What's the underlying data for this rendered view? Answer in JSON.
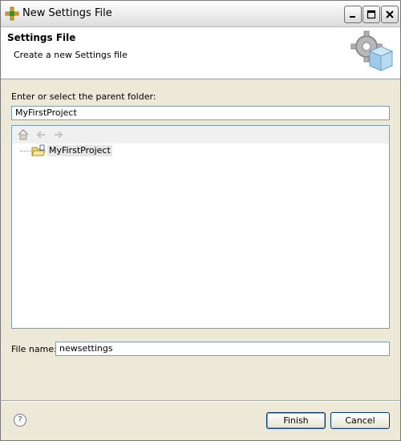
{
  "window": {
    "title": "New Settings File"
  },
  "banner": {
    "title": "Settings File",
    "description": "Create a new Settings file"
  },
  "parent_folder": {
    "label": "Enter or select the parent folder:",
    "value": "MyFirstProject"
  },
  "tree": {
    "toolbar_icons": [
      "home-icon",
      "back-arrow-icon",
      "forward-arrow-icon"
    ],
    "items": [
      {
        "label": "MyFirstProject",
        "icon": "project-folder-icon"
      }
    ]
  },
  "file_name": {
    "label": "File name:",
    "value": "newsettings"
  },
  "footer": {
    "help_symbol": "?",
    "finish_label": "Finish",
    "cancel_label": "Cancel"
  },
  "colors": {
    "dialog_bg": "#ece9d8",
    "banner_bg": "#ffffff",
    "field_border": "#7f9db9",
    "button_border": "#003c74"
  }
}
